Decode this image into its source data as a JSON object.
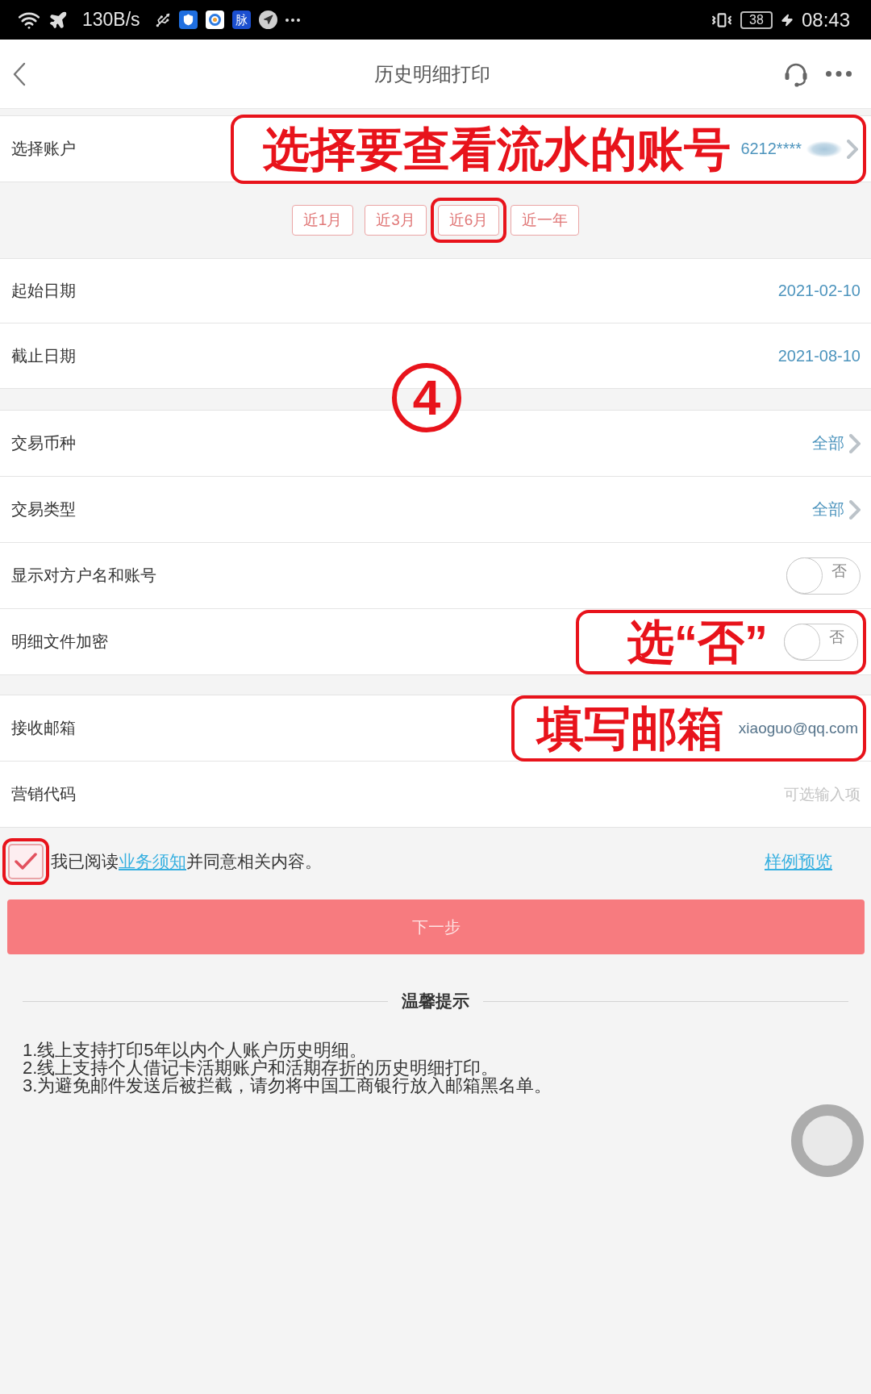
{
  "status_bar": {
    "net_speed": "130B/s",
    "app_tile": "脉",
    "battery": "38",
    "time": "08:43"
  },
  "header": {
    "title": "历史明细打印"
  },
  "account": {
    "label": "选择账户",
    "value": "6212****",
    "annotation": "选择要查看流水的账号"
  },
  "periods": [
    {
      "label": "近1月",
      "selected": false,
      "highlighted": false
    },
    {
      "label": "近3月",
      "selected": false,
      "highlighted": false
    },
    {
      "label": "近6月",
      "selected": false,
      "highlighted": true
    },
    {
      "label": "近一年",
      "selected": false,
      "highlighted": false
    }
  ],
  "date_rows": [
    {
      "label": "起始日期",
      "value": "2021-02-10"
    },
    {
      "label": "截止日期",
      "value": "2021-08-10"
    }
  ],
  "step_number": "4",
  "filter_rows": [
    {
      "kind": "select",
      "label": "交易币种",
      "value": "全部"
    },
    {
      "kind": "select",
      "label": "交易类型",
      "value": "全部"
    },
    {
      "kind": "toggle",
      "label": "显示对方户名和账号",
      "on": false,
      "toggle_text": "否"
    },
    {
      "kind": "toggle",
      "label": "明细文件加密",
      "on": false,
      "toggle_text": "否",
      "annotation": "选“否”"
    }
  ],
  "input_rows": [
    {
      "label": "接收邮箱",
      "value": "xiaoguo@qq.com",
      "annotation": "填写邮箱"
    },
    {
      "label": "营销代码",
      "placeholder": "可选输入项"
    }
  ],
  "agreement": {
    "checked": true,
    "highlighted": true,
    "text_before": "我已阅读",
    "link": "业务须知",
    "text_after": "并同意相关内容。",
    "preview_link": "样例预览"
  },
  "next_button": {
    "label": "下一步",
    "disabled": true
  },
  "tips": {
    "title": "温馨提示",
    "items": [
      "1.线上支持打印5年以内个人账户历史明细。",
      "2.线上支持个人借记卡活期账户和活期存折的历史明细打印。",
      "3.为避免邮件发送后被拦截，请勿将中国工商银行放入邮箱黑名单。"
    ]
  }
}
